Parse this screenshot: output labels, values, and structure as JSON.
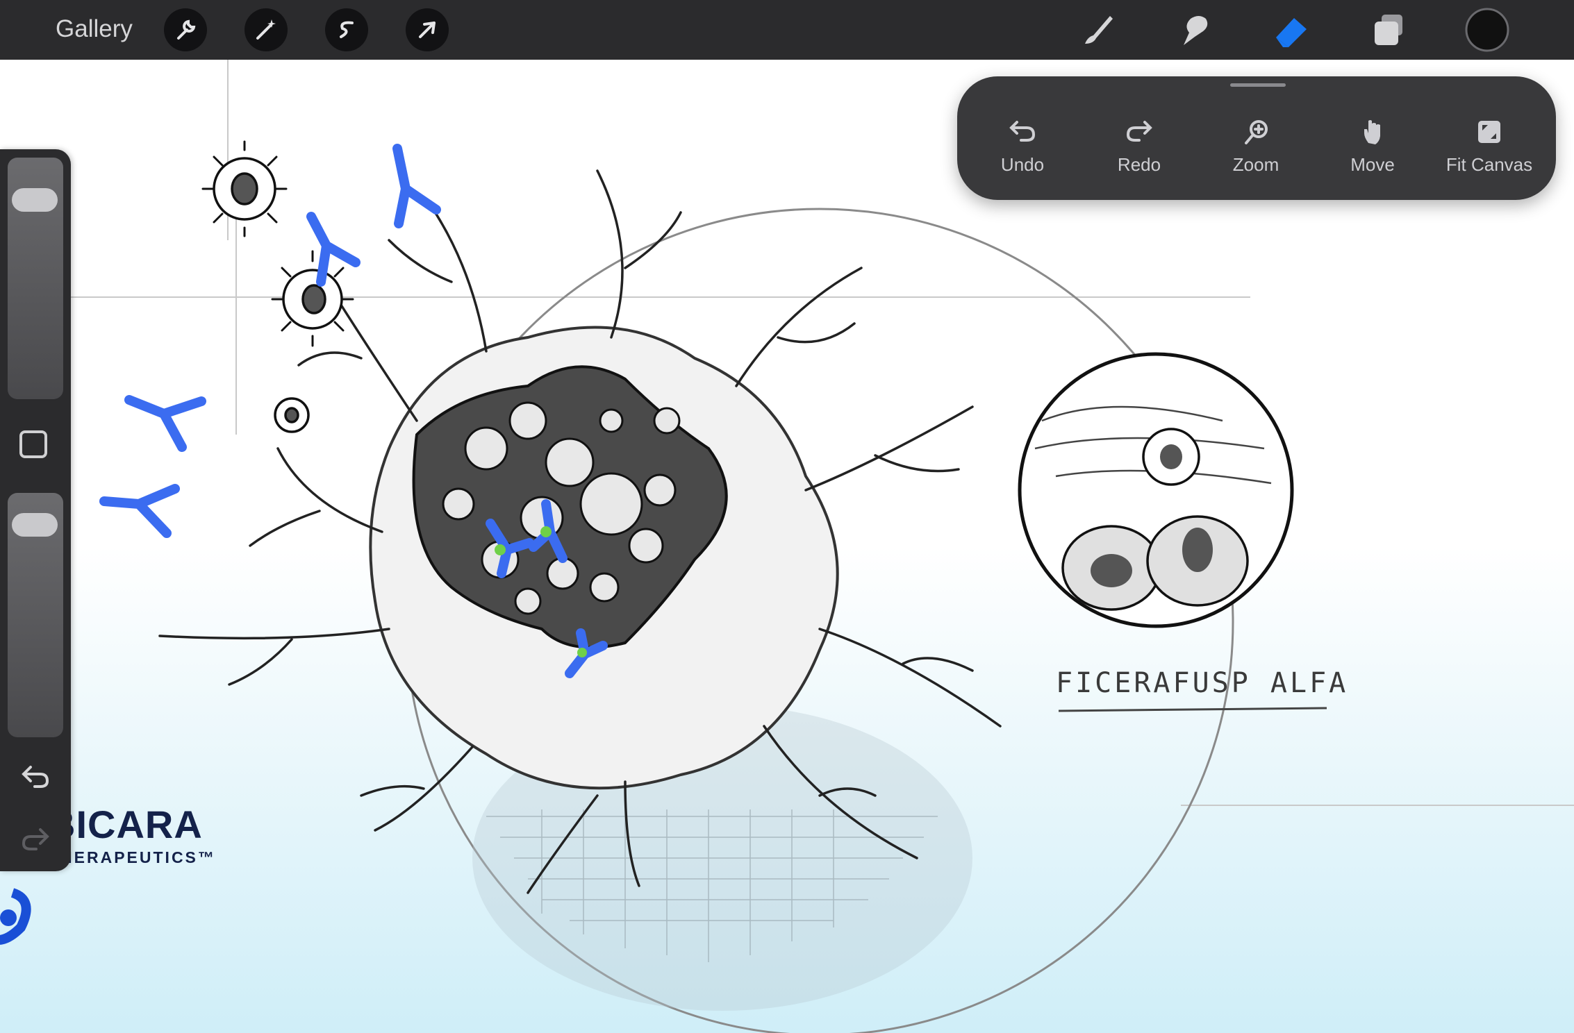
{
  "topbar": {
    "gallery_label": "Gallery",
    "left_tools": [
      "wrench-icon",
      "magic-wand-icon",
      "selection-icon",
      "transform-arrow-icon"
    ],
    "right_tools": [
      "brush-icon",
      "smudge-icon",
      "eraser-icon",
      "layers-icon",
      "color-swatch"
    ],
    "active_tool": "eraser",
    "active_color": "#1877f2",
    "swatch_color": "#111111"
  },
  "quick_menu": {
    "items": [
      {
        "label": "Undo",
        "icon": "undo-icon"
      },
      {
        "label": "Redo",
        "icon": "redo-icon"
      },
      {
        "label": "Zoom",
        "icon": "zoom-icon"
      },
      {
        "label": "Move",
        "icon": "hand-icon"
      },
      {
        "label": "Fit Canvas",
        "icon": "fit-canvas-icon"
      }
    ]
  },
  "sidebar": {
    "brush_size_level": 0.88,
    "opacity_level": 0.93,
    "controls": [
      "modify-button",
      "undo-icon",
      "redo-icon"
    ]
  },
  "artwork": {
    "caption": "FICERAFUSP ALFA",
    "logo_name": "BICARA",
    "logo_sub": "THERAPEUTICS™",
    "antibody_color": "#3b6cf0",
    "binding_color": "#6fd048",
    "logo_color": "#1a4fd6"
  }
}
